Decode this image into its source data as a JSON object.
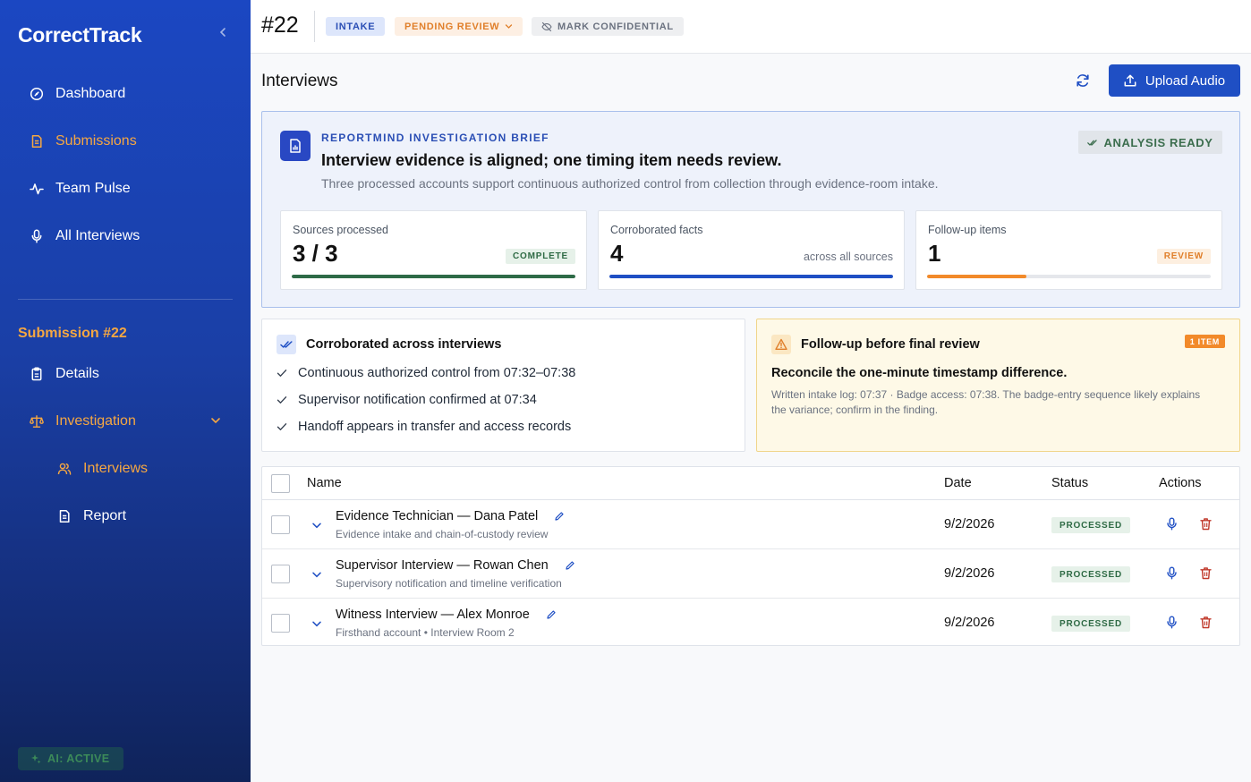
{
  "app": {
    "brand": "CorrectTrack"
  },
  "sidebar": {
    "nav": [
      {
        "label": "Dashboard",
        "icon": "dashboard-icon"
      },
      {
        "label": "Submissions",
        "icon": "document-icon"
      },
      {
        "label": "Team Pulse",
        "icon": "pulse-icon"
      },
      {
        "label": "All Interviews",
        "icon": "microphone-icon"
      }
    ],
    "section_title": "Submission #22",
    "sub_nav": [
      {
        "label": "Details",
        "icon": "clipboard-icon"
      },
      {
        "label": "Investigation",
        "icon": "scale-icon"
      },
      {
        "label": "Interviews",
        "icon": "people-icon"
      },
      {
        "label": "Report",
        "icon": "document-icon"
      }
    ],
    "ai_status": "AI: ACTIVE"
  },
  "topbar": {
    "case_number": "#22",
    "tag_intake": "INTAKE",
    "tag_pending": "PENDING REVIEW",
    "tag_confidential": "MARK CONFIDENTIAL"
  },
  "main": {
    "title": "Interviews",
    "upload_label": "Upload Audio"
  },
  "brief": {
    "kicker": "REPORTMIND INVESTIGATION BRIEF",
    "headline": "Interview evidence is aligned; one timing item needs review.",
    "subtext": "Three processed accounts support continuous authorized control from collection through evidence-room intake.",
    "status": "ANALYSIS READY",
    "stats": [
      {
        "label": "Sources processed",
        "value": "3 / 3",
        "pill": "COMPLETE",
        "progress": 1.0,
        "color": "#2e6b47"
      },
      {
        "label": "Corroborated facts",
        "value": "4",
        "note": "across all sources",
        "progress": 1.0,
        "color": "#1f4fc4"
      },
      {
        "label": "Follow-up items",
        "value": "1",
        "pill": "REVIEW",
        "progress": 0.35,
        "color": "#f28a2a"
      }
    ]
  },
  "corroborated": {
    "title": "Corroborated across interviews",
    "items": [
      "Continuous authorized control from 07:32–07:38",
      "Supervisor notification confirmed at 07:34",
      "Handoff appears in transfer and access records"
    ]
  },
  "followup": {
    "title": "Follow-up before final review",
    "badge": "1 ITEM",
    "headline": "Reconcile the one-minute timestamp difference.",
    "body": "Written intake log: 07:37 · Badge access: 07:38. The badge-entry sequence likely explains the variance; confirm in the finding."
  },
  "table": {
    "headers": {
      "name": "Name",
      "date": "Date",
      "status": "Status",
      "actions": "Actions"
    },
    "rows": [
      {
        "name": "Evidence Technician — Dana Patel",
        "sub": "Evidence intake and chain-of-custody review",
        "date": "9/2/2026",
        "status": "PROCESSED"
      },
      {
        "name": "Supervisor Interview — Rowan Chen",
        "sub": "Supervisory notification and timeline verification",
        "date": "9/2/2026",
        "status": "PROCESSED"
      },
      {
        "name": "Witness Interview — Alex Monroe",
        "sub": "Firsthand account • Interview Room 2",
        "date": "9/2/2026",
        "status": "PROCESSED"
      }
    ]
  },
  "colors": {
    "primary": "#1f4fc4",
    "accent": "#f5a742",
    "success": "#2e6b47",
    "warning": "#f28a2a",
    "danger": "#c0392b"
  }
}
